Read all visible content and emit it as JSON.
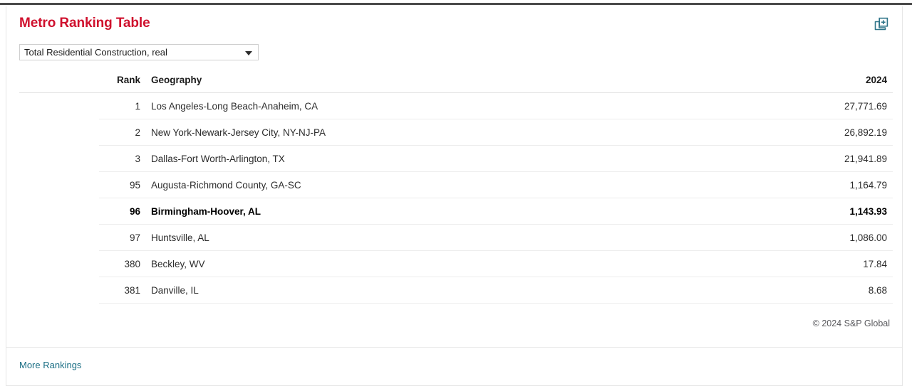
{
  "header": {
    "title": "Metro Ranking Table",
    "action_icon": "add-to-dashboard-icon"
  },
  "selector": {
    "value": "Total Residential Construction, real",
    "caret_icon": "chevron-down-icon"
  },
  "table": {
    "columns": {
      "rank": "Rank",
      "geography": "Geography",
      "value": "2024"
    },
    "rows": [
      {
        "rank": "1",
        "geography": "Los Angeles-Long Beach-Anaheim, CA",
        "value": "27,771.69",
        "highlighted": false
      },
      {
        "rank": "2",
        "geography": "New York-Newark-Jersey City, NY-NJ-PA",
        "value": "26,892.19",
        "highlighted": false
      },
      {
        "rank": "3",
        "geography": "Dallas-Fort Worth-Arlington, TX",
        "value": "21,941.89",
        "highlighted": false
      },
      {
        "rank": "95",
        "geography": "Augusta-Richmond County, GA-SC",
        "value": "1,164.79",
        "highlighted": false
      },
      {
        "rank": "96",
        "geography": "Birmingham-Hoover, AL",
        "value": "1,143.93",
        "highlighted": true
      },
      {
        "rank": "97",
        "geography": "Huntsville, AL",
        "value": "1,086.00",
        "highlighted": false
      },
      {
        "rank": "380",
        "geography": "Beckley, WV",
        "value": "17.84",
        "highlighted": false
      },
      {
        "rank": "381",
        "geography": "Danville, IL",
        "value": "8.68",
        "highlighted": false
      }
    ]
  },
  "footer": {
    "copyright": "© 2024 S&P Global",
    "more_rankings": "More Rankings"
  },
  "colors": {
    "title_red": "#cf102d",
    "link_teal": "#1a6e84",
    "icon_teal": "#2e7489"
  }
}
